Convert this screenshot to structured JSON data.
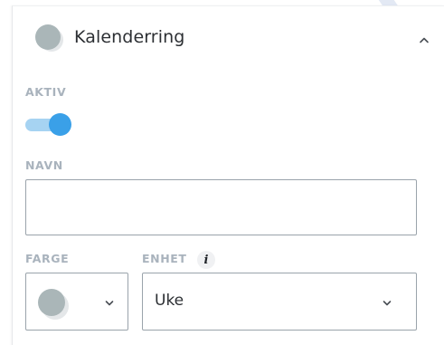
{
  "header": {
    "title": "Kalenderring",
    "color_swatch": "#aab6b8",
    "collapse_icon": "chevron-up-icon"
  },
  "fields": {
    "active": {
      "label": "AKTIV",
      "value": true,
      "on_color": "#3aa0e8"
    },
    "name": {
      "label": "NAVN",
      "value": ""
    },
    "color": {
      "label": "FARGE",
      "value": "#aab6b8"
    },
    "unit": {
      "label": "ENHET",
      "value": "Uke",
      "info_glyph": "i",
      "info_icon": "info-icon"
    }
  }
}
